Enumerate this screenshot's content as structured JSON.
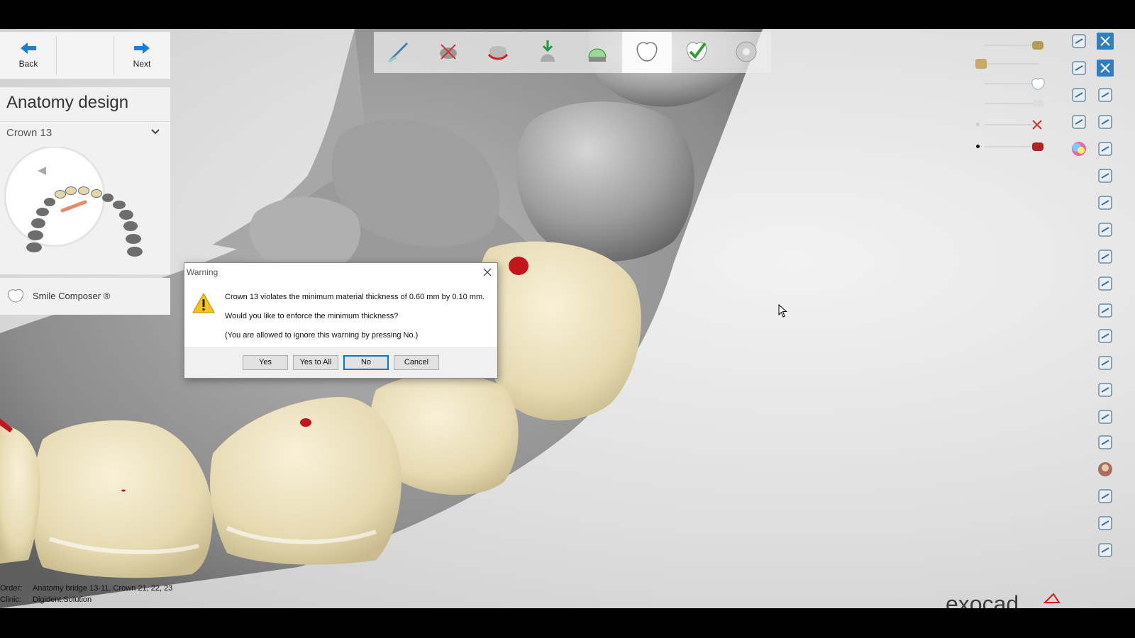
{
  "nav": {
    "back_label": "Back",
    "next_label": "Next"
  },
  "panel": {
    "title": "Anatomy design",
    "crown_select": "Crown 13",
    "smile_composer_label": "Smile Composer ®"
  },
  "workflow_steps": [
    {
      "icon": "prepare-scan-icon"
    },
    {
      "icon": "cut-dies-icon"
    },
    {
      "icon": "margin-line-icon"
    },
    {
      "icon": "insertion-direction-icon"
    },
    {
      "icon": "cement-gap-icon"
    },
    {
      "icon": "anatomy-tooth-icon",
      "active": true
    },
    {
      "icon": "finish-checkmark-icon"
    },
    {
      "icon": "milling-disc-icon"
    }
  ],
  "dialog": {
    "title": "Warning",
    "line1": "Crown 13 violates the minimum material thickness of 0.60 mm by 0.10 mm.",
    "line2": "Would you like to enforce the minimum thickness?",
    "line3": "(You are allowed to ignore this warning by pressing No.)",
    "buttons": {
      "yes": "Yes",
      "yes_to_all": "Yes to All",
      "no": "No",
      "cancel": "Cancel"
    }
  },
  "info": {
    "order_key": "Order:",
    "order_value": "Anatomy bridge 13-11, Crown 21, 22, 23",
    "clinic_key": "Clinic:",
    "clinic_value": "Digident.Solution"
  },
  "brand_logo_text": "exocad",
  "colors": {
    "accent": "#0078d7",
    "nav_arrow": "#1e7fd0",
    "crown": "#ece2bf",
    "model": "#8e8e8e",
    "contact_mark": "#c4141c"
  }
}
